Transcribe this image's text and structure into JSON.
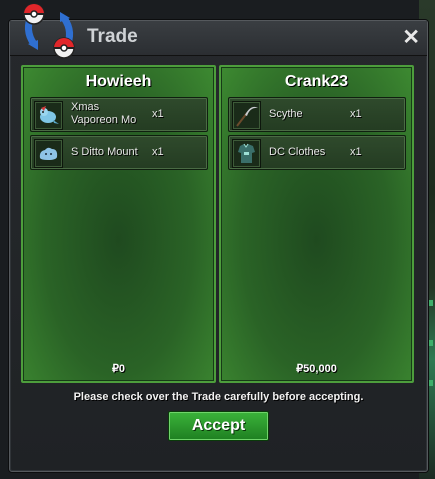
{
  "window": {
    "title": "Trade",
    "close_label": "✕"
  },
  "left_panel": {
    "player": "Howieeh",
    "items": [
      {
        "name": "Xmas Vaporeon Mo",
        "qty": "x1",
        "icon": "vaporeon-icon"
      },
      {
        "name": "S Ditto Mount",
        "qty": "x1",
        "icon": "ditto-icon"
      }
    ],
    "money": "₽0"
  },
  "right_panel": {
    "player": "Crank23",
    "items": [
      {
        "name": "Scythe",
        "qty": "x1",
        "icon": "scythe-icon"
      },
      {
        "name": "DC Clothes",
        "qty": "x1",
        "icon": "clothes-icon"
      }
    ],
    "money": "₽50,000"
  },
  "footer": {
    "hint": "Please check over the Trade carefully before accepting.",
    "accept_label": "Accept"
  },
  "colors": {
    "panel_green": "#2a6326",
    "accept_green": "#2a9a2b",
    "window_bg": "#222529"
  }
}
